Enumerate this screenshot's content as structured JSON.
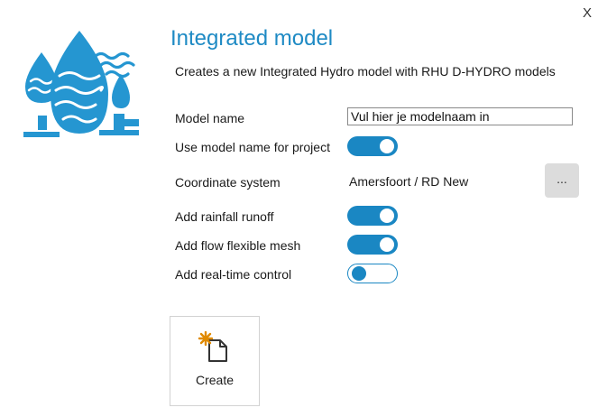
{
  "window": {
    "close_label": "X"
  },
  "header": {
    "title": "Integrated model",
    "subtitle": "Creates a new Integrated Hydro model with RHU D-HYDRO models"
  },
  "form": {
    "model_name_label": "Model name",
    "model_name_value": "Vul hier je modelnaam in",
    "use_model_name_label": "Use model name for project",
    "use_model_name_on": true,
    "coordinate_system_label": "Coordinate system",
    "coordinate_system_value": "Amersfoort / RD New",
    "browse_label": "...",
    "rainfall_runoff_label": "Add rainfall runoff",
    "rainfall_runoff_on": true,
    "flow_mesh_label": "Add flow flexible mesh",
    "flow_mesh_on": true,
    "rtc_label": "Add real-time control",
    "rtc_on": false
  },
  "actions": {
    "create_label": "Create"
  },
  "colors": {
    "accent": "#1a87c3",
    "title": "#1e8ac4",
    "star": "#e08a00"
  }
}
